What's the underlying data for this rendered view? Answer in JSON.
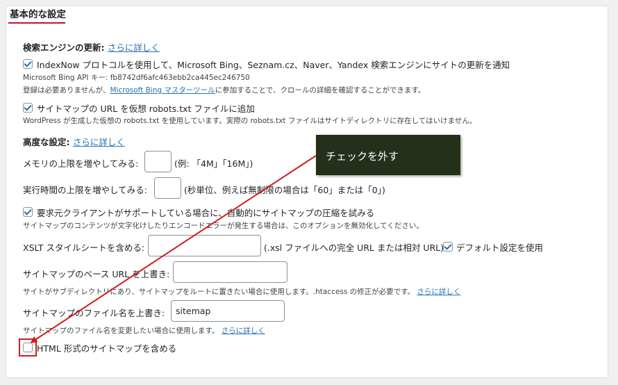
{
  "section": {
    "title": "基本的な設定"
  },
  "search_engine": {
    "heading": "検索エンジンの更新:",
    "more_link": "さらに詳しく",
    "indexnow_label": "IndexNow プロトコルを使用して、Microsoft Bing、Seznam.cz、Naver、Yandex 検索エンジンにサイトの更新を通知",
    "api_key": "Microsoft Bing API キー: fb8742df6afc463ebb2ca445ec246750",
    "reg_prefix": "登録は必要ありませんが、",
    "reg_link": "Microsoft Bing マスターツール",
    "reg_suffix": "に参加することで、クロールの詳細を確認することができます。",
    "robots_label": "サイトマップの URL を仮想 robots.txt ファイルに追加",
    "robots_note": "WordPress が生成した仮想の robots.txt を使用しています。実際の robots.txt ファイルはサイトディレクトリに存在してはいけません。"
  },
  "advanced": {
    "heading": "高度な設定:",
    "more_link": "さらに詳しく",
    "memory_label": "メモリの上限を増やしてみる:",
    "memory_value": "",
    "memory_hint": "(例: 「4M」「16M」)",
    "time_label": "実行時間の上限を増やしてみる:",
    "time_value": "",
    "time_hint": "(秒単位、例えば無制限の場合は「60」または「0」)",
    "compress_label": "要求元クライアントがサポートしている場合に、自動的にサイトマップの圧縮を試みる",
    "compress_note": "サイトマップのコンテンツが文字化けしたりエンコードエラーが発生する場合は、このオプションを無効化してください。",
    "xslt_label": "XSLT スタイルシートを含める:",
    "xslt_value": "",
    "xslt_hint": "(.xsl ファイルへの完全 URL または相対 URL)",
    "xslt_default_label": "デフォルト設定を使用",
    "base_url_label": "サイトマップのベース URL を上書き:",
    "base_url_value": "",
    "base_url_note": "サイトがサブディレクトリにあり、サイトマップをルートに置きたい場合に使用します。.htaccess の修正が必要です。",
    "base_url_link": "さらに詳しく",
    "filename_label": "サイトマップのファイル名を上書き:",
    "filename_value": "sitemap",
    "filename_note": "サイトマップのファイル名を変更したい場合に使用します。",
    "filename_link": "さらに詳しく",
    "html_sitemap_label": "HTML 形式のサイトマップを含める"
  },
  "annotation": {
    "tooltip": "チェックを外す",
    "color": "#d01c1c"
  }
}
